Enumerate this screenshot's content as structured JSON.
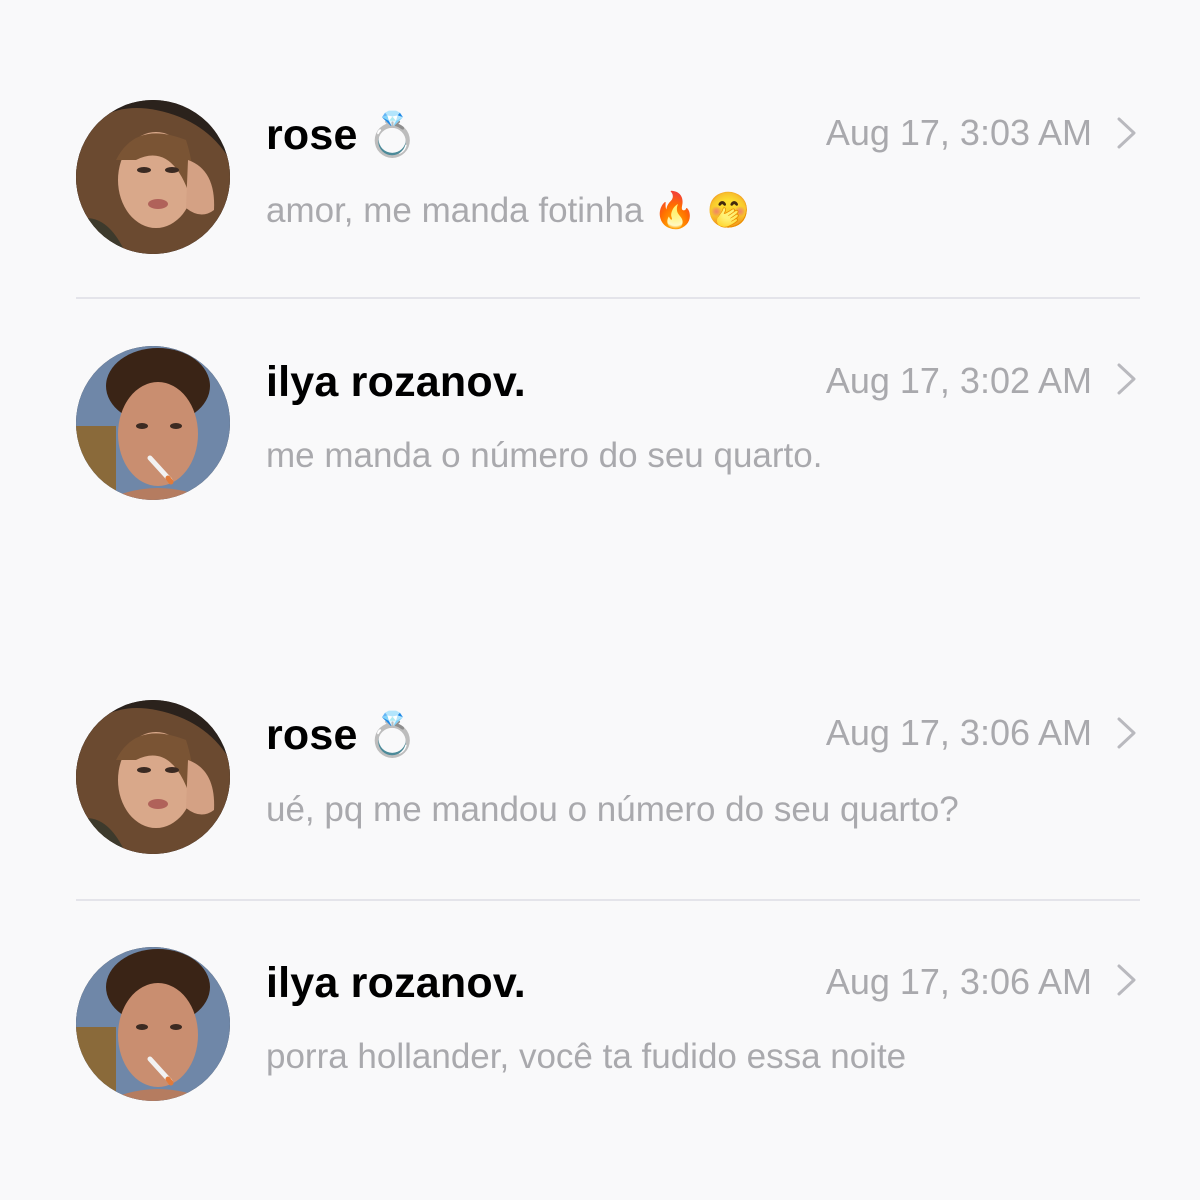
{
  "conversations": [
    {
      "name": "rose",
      "name_emoji": "💍",
      "time": "Aug 17, 3:03 AM",
      "preview": "amor, me manda fotinha 🔥 🤭",
      "avatar": "woman-portrait"
    },
    {
      "name": "ilya rozanov.",
      "name_emoji": "",
      "time": "Aug 17, 3:02 AM",
      "preview": "me manda o número do seu quarto.",
      "avatar": "man-portrait"
    },
    {
      "name": "rose",
      "name_emoji": "💍",
      "time": "Aug 17, 3:06 AM",
      "preview": "ué, pq me mandou o número do seu quarto?",
      "avatar": "woman-portrait"
    },
    {
      "name": "ilya rozanov.",
      "name_emoji": "",
      "time": "Aug 17, 3:06 AM",
      "preview": "porra hollander, você ta fudido essa noite",
      "avatar": "man-portrait"
    }
  ],
  "colors": {
    "background": "#f9f9fa",
    "name": "#000000",
    "secondary_text": "#a9a9ad",
    "divider": "#e4e4ea",
    "chevron": "#b9b9be"
  },
  "icons": {
    "disclosure": "chevron-right-icon"
  }
}
